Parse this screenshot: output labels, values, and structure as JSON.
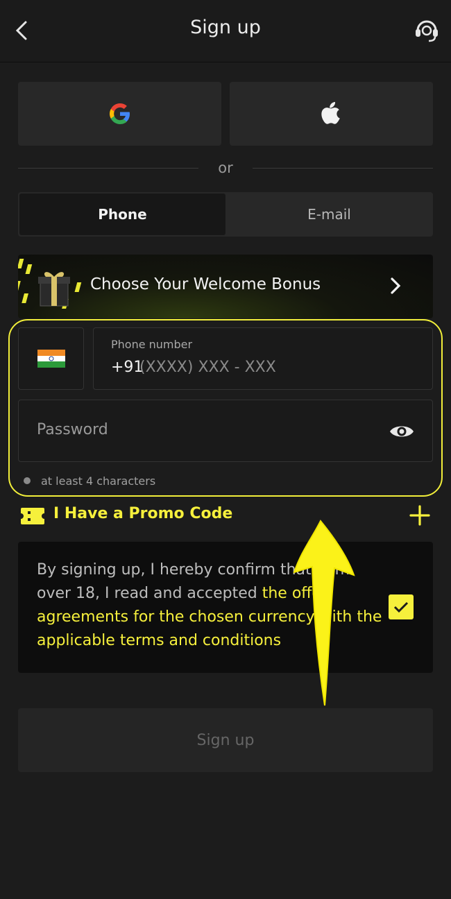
{
  "header": {
    "title": "Sign up",
    "back_icon": "chevron-left-icon",
    "support_icon": "headset-icon"
  },
  "social": {
    "google_icon": "google-icon",
    "apple_icon": "apple-icon"
  },
  "divider": {
    "or_text": "or"
  },
  "tabs": [
    {
      "label": "Phone",
      "active": true
    },
    {
      "label": "E-mail",
      "active": false
    }
  ],
  "bonus": {
    "label": "Choose Your Welcome Bonus"
  },
  "phone": {
    "country_flag": "india-flag-icon",
    "label": "Phone number",
    "prefix": "+91",
    "placeholder": "(XXXX) XXX - XXX"
  },
  "password": {
    "placeholder": "Password",
    "hint": "at least 4 characters"
  },
  "promo": {
    "label": "I Have a Promo Code"
  },
  "terms": {
    "text_before": "By signing up, I hereby confirm that I am over 18, I read and accepted ",
    "link_text": "the offer agreements for the chosen currency with the applicable terms and conditions",
    "checked": true
  },
  "submit": {
    "label": "Sign up"
  },
  "colors": {
    "accent": "#f6f03c",
    "background": "#1c1c1c",
    "surface": "#282828"
  }
}
